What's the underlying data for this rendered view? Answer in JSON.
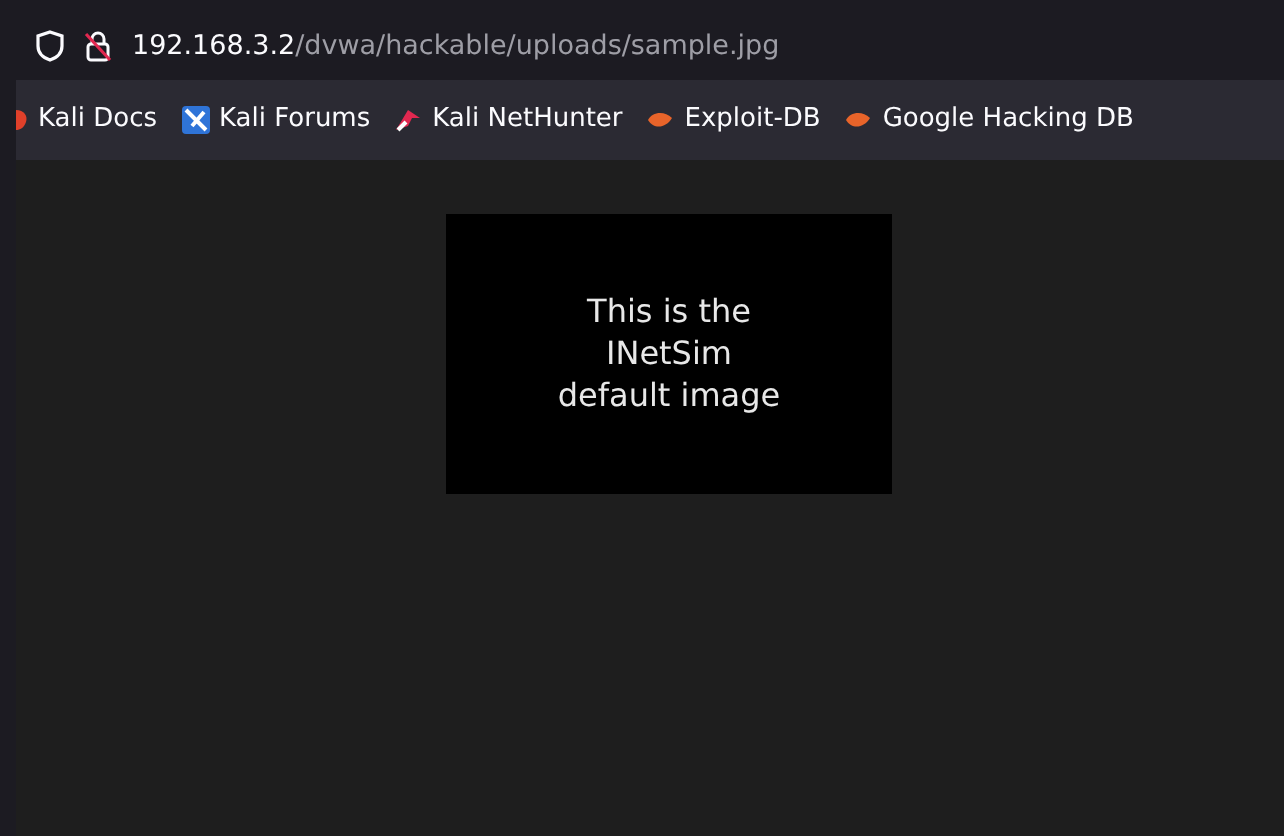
{
  "address_bar": {
    "host": "192.168.3.2",
    "path": "/dvwa/hackable/uploads/sample.jpg",
    "insecure": true
  },
  "bookmarks": [
    {
      "label": "Kali Docs",
      "kind": "kali"
    },
    {
      "label": "Kali Forums",
      "kind": "forums"
    },
    {
      "label": "Kali NetHunter",
      "kind": "nethunter"
    },
    {
      "label": "Exploit-DB",
      "kind": "exploit"
    },
    {
      "label": "Google Hacking DB",
      "kind": "exploit"
    }
  ],
  "image": {
    "lines": [
      "This is the",
      "INetSim",
      "default image"
    ]
  }
}
